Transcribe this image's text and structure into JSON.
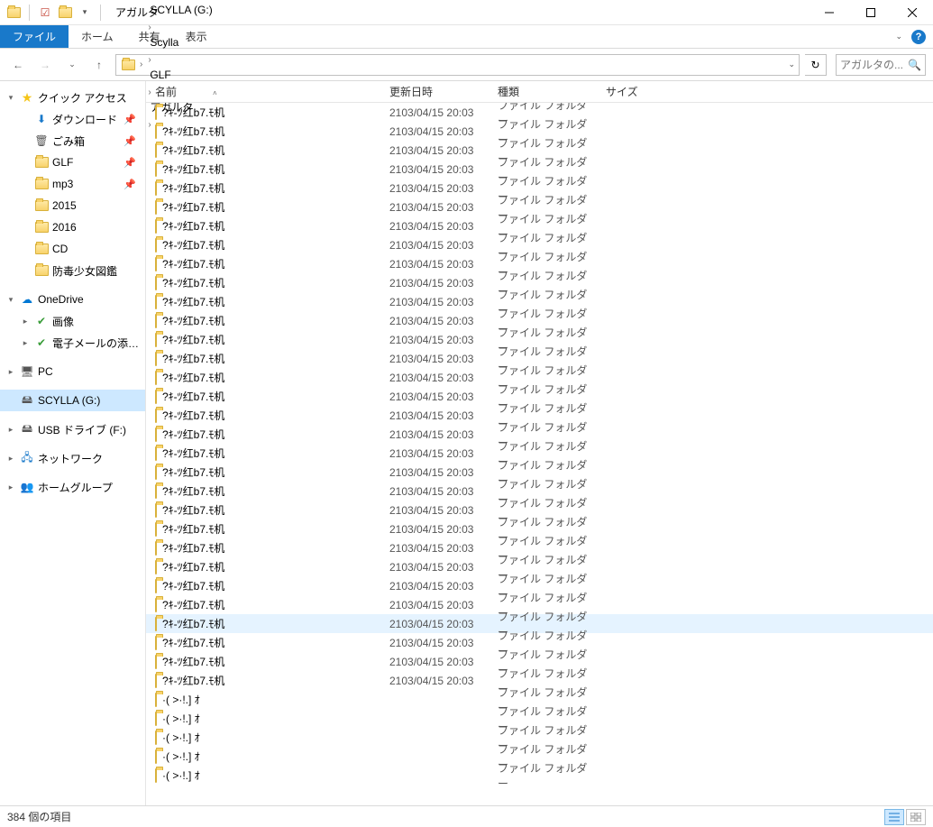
{
  "title": "アガルタ",
  "ribbon": {
    "file": "ファイル",
    "home": "ホーム",
    "share": "共有",
    "view": "表示"
  },
  "breadcrumbs": [
    "SCYLLA (G:)",
    "Scylla",
    "GLF",
    "アガルタ"
  ],
  "search_placeholder": "アガルタの...",
  "columns": {
    "name": "名前",
    "date": "更新日時",
    "type": "種類",
    "size": "サイズ"
  },
  "sidebar": {
    "quick_access": "クイック アクセス",
    "qa_items": [
      {
        "label": "ダウンロード",
        "pinned": true,
        "icon": "download"
      },
      {
        "label": "ごみ箱",
        "pinned": true,
        "icon": "recycle"
      },
      {
        "label": "GLF",
        "pinned": true,
        "icon": "folder"
      },
      {
        "label": "mp3",
        "pinned": true,
        "icon": "folder"
      },
      {
        "label": "2015",
        "pinned": false,
        "icon": "folder"
      },
      {
        "label": "2016",
        "pinned": false,
        "icon": "folder"
      },
      {
        "label": "CD",
        "pinned": false,
        "icon": "folder"
      },
      {
        "label": "防毒少女図鑑",
        "pinned": false,
        "icon": "folder"
      }
    ],
    "onedrive": "OneDrive",
    "od_items": [
      "画像",
      "電子メールの添付ファ"
    ],
    "pc": "PC",
    "scylla": "SCYLLA (G:)",
    "usb": "USB ドライブ (F:)",
    "network": "ネットワーク",
    "homegroup": "ホームグループ"
  },
  "folder_type": "ファイル フォルダー",
  "folder_date": "2103/04/15 20:03",
  "rows": [
    {
      "name": "?ｷ-ﾂ红b7.ﾓ机",
      "hasDate": true
    },
    {
      "name": "?ｷ-ﾂ红b7.ﾓ机",
      "hasDate": true
    },
    {
      "name": "?ｷ-ﾂ红b7.ﾓ机",
      "hasDate": true
    },
    {
      "name": "?ｷ-ﾂ红b7.ﾓ机",
      "hasDate": true
    },
    {
      "name": "?ｷ-ﾂ红b7.ﾓ机",
      "hasDate": true
    },
    {
      "name": "?ｷ-ﾂ红b7.ﾓ机",
      "hasDate": true
    },
    {
      "name": "?ｷ-ﾂ红b7.ﾓ机",
      "hasDate": true
    },
    {
      "name": "?ｷ-ﾂ红b7.ﾓ机",
      "hasDate": true
    },
    {
      "name": "?ｷ-ﾂ红b7.ﾓ机",
      "hasDate": true
    },
    {
      "name": "?ｷ-ﾂ红b7.ﾓ机",
      "hasDate": true
    },
    {
      "name": "?ｷ-ﾂ红b7.ﾓ机",
      "hasDate": true
    },
    {
      "name": "?ｷ-ﾂ红b7.ﾓ机",
      "hasDate": true
    },
    {
      "name": "?ｷ-ﾂ红b7.ﾓ机",
      "hasDate": true
    },
    {
      "name": "?ｷ-ﾂ红b7.ﾓ机",
      "hasDate": true
    },
    {
      "name": "?ｷ-ﾂ红b7.ﾓ机",
      "hasDate": true
    },
    {
      "name": "?ｷ-ﾂ红b7.ﾓ机",
      "hasDate": true
    },
    {
      "name": "?ｷ-ﾂ红b7.ﾓ机",
      "hasDate": true
    },
    {
      "name": "?ｷ-ﾂ红b7.ﾓ机",
      "hasDate": true
    },
    {
      "name": "?ｷ-ﾂ红b7.ﾓ机",
      "hasDate": true
    },
    {
      "name": "?ｷ-ﾂ红b7.ﾓ机",
      "hasDate": true
    },
    {
      "name": "?ｷ-ﾂ红b7.ﾓ机",
      "hasDate": true
    },
    {
      "name": "?ｷ-ﾂ红b7.ﾓ机",
      "hasDate": true
    },
    {
      "name": "?ｷ-ﾂ红b7.ﾓ机",
      "hasDate": true
    },
    {
      "name": "?ｷ-ﾂ红b7.ﾓ机",
      "hasDate": true
    },
    {
      "name": "?ｷ-ﾂ红b7.ﾓ机",
      "hasDate": true
    },
    {
      "name": "?ｷ-ﾂ红b7.ﾓ机",
      "hasDate": true
    },
    {
      "name": "?ｷ-ﾂ红b7.ﾓ机",
      "hasDate": true
    },
    {
      "name": "?ｷ-ﾂ红b7.ﾓ机",
      "hasDate": true,
      "hover": true
    },
    {
      "name": "?ｷ-ﾂ红b7.ﾓ机",
      "hasDate": true
    },
    {
      "name": "?ｷ-ﾂ红b7.ﾓ机",
      "hasDate": true
    },
    {
      "name": "?ｷ-ﾂ红b7.ﾓ机",
      "hasDate": true
    },
    {
      "name": "·( >·!.] ｵ",
      "hasDate": false
    },
    {
      "name": "·( >·!.] ｵ",
      "hasDate": false
    },
    {
      "name": "·( >·!.] ｵ",
      "hasDate": false
    },
    {
      "name": "·( >·!.] ｵ",
      "hasDate": false
    },
    {
      "name": "·( >·!.] ｵ",
      "hasDate": false
    }
  ],
  "status": "384 個の項目"
}
